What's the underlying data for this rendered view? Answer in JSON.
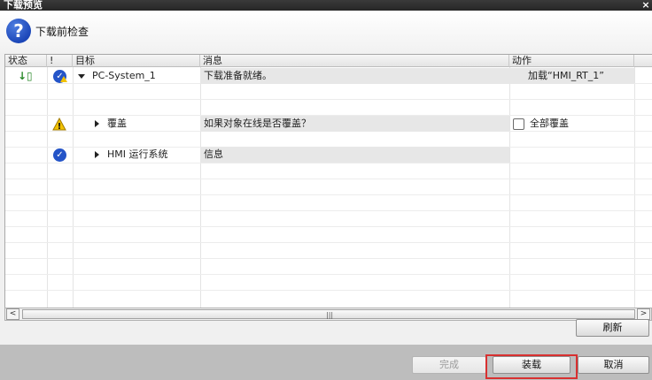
{
  "window": {
    "title": "下载预览",
    "close_symbol": "×"
  },
  "header": {
    "icon_symbol": "?",
    "title": "下载前检查"
  },
  "table": {
    "columns": [
      "状态",
      "!",
      "目标",
      "消息",
      "动作"
    ],
    "rows": [
      {
        "status_icon": "download-arrow-icon",
        "status_glyph": "↓▯",
        "alert_icon": "check-warning-icon",
        "target": "PC-System_1",
        "message": "下载准备就绪。",
        "action": "加载“HMI_RT_1”",
        "expanded": true
      },
      {
        "alert_icon": "warning-icon",
        "alert_glyph": "!",
        "target": "覆盖",
        "message": "如果对象在线是否覆盖？",
        "action": "全部覆盖",
        "action_checkbox_checked": false,
        "expanded": false
      },
      {
        "alert_icon": "check-icon",
        "alert_glyph": "✓",
        "target": "HMI 运行系统",
        "message": "信息",
        "action": "",
        "expanded": false
      }
    ]
  },
  "scrollbar": {
    "left_arrow": "<",
    "right_arrow": ">",
    "grip": "|||"
  },
  "buttons": {
    "refresh": "刷新",
    "finish": "完成",
    "load": "装载",
    "cancel": "取消"
  },
  "colors": {
    "accent_blue": "#2454c8",
    "warning_yellow": "#f2c200",
    "highlight_red": "#d83030"
  }
}
